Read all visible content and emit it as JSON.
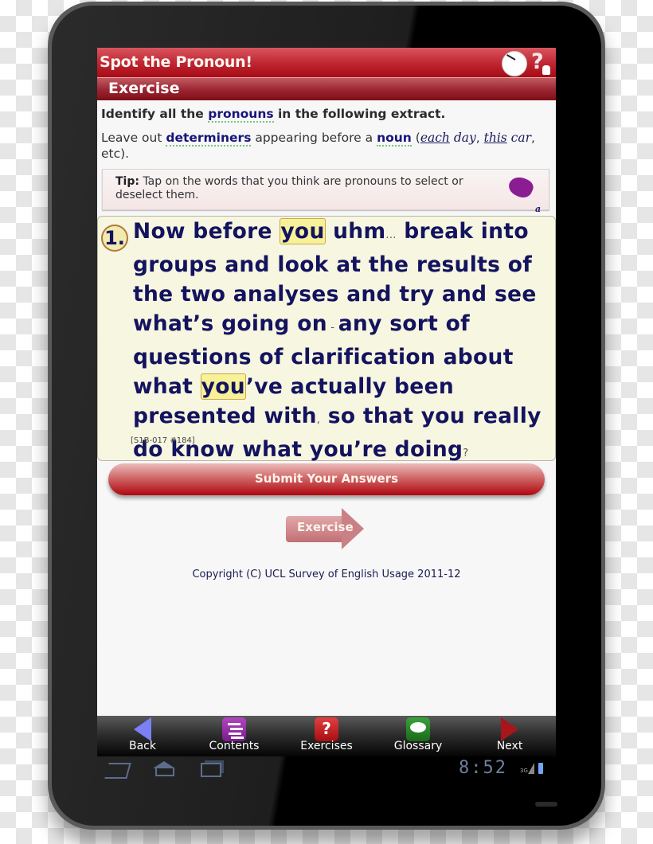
{
  "app": {
    "title": "Spot the Pronoun!",
    "section": "Exercise",
    "header_icons": [
      "clock-icon",
      "help-icon"
    ]
  },
  "instructions": {
    "line1_pre": "Identify all the ",
    "line1_term": "pronouns",
    "line1_post": " in the following extract.",
    "line2_pre": "Leave out ",
    "line2_term1": "determiners",
    "line2_mid": " appearing before a ",
    "line2_term2": "noun",
    "line2_paren_open": " (",
    "example1_word": "each",
    "example1_rest": " day",
    "sep": ", ",
    "example2_word": "this",
    "example2_rest": " car",
    "line2_end": ", etc)."
  },
  "tip": {
    "label": "Tip:",
    "text": " Tap on the words that you think are pronouns to select or deselect them.",
    "icon_label": "a"
  },
  "passage": {
    "number": "1.",
    "words": [
      {
        "t": "Now",
        "s": false
      },
      {
        "t": "before",
        "s": false
      },
      {
        "t": "you",
        "s": true
      },
      {
        "t": "uhm",
        "s": false
      },
      {
        "p": "..."
      },
      {
        "t": "break",
        "s": false
      },
      {
        "t": "into",
        "s": false
      },
      {
        "t": "groups",
        "s": false
      },
      {
        "t": "and",
        "s": false
      },
      {
        "t": "look",
        "s": false
      },
      {
        "t": "at",
        "s": false
      },
      {
        "t": "the",
        "s": false
      },
      {
        "t": "results",
        "s": false
      },
      {
        "t": "of",
        "s": false
      },
      {
        "t": "the",
        "s": false
      },
      {
        "t": "two",
        "s": false
      },
      {
        "t": "analyses",
        "s": false
      },
      {
        "t": "and",
        "s": false
      },
      {
        "t": "try",
        "s": false
      },
      {
        "t": "and",
        "s": false
      },
      {
        "t": "see",
        "s": false
      },
      {
        "t": "what’s",
        "s": false
      },
      {
        "t": "going",
        "s": false
      },
      {
        "t": "on",
        "s": false
      },
      {
        "p": " - "
      },
      {
        "t": "any",
        "s": false
      },
      {
        "t": "sort",
        "s": false
      },
      {
        "t": "of",
        "s": false
      },
      {
        "t": "questions",
        "s": false
      },
      {
        "t": "of",
        "s": false
      },
      {
        "t": "clarification",
        "s": false
      },
      {
        "t": "about",
        "s": false
      },
      {
        "t": "what",
        "s": false
      },
      {
        "t": "you",
        "s": true,
        "join": true
      },
      {
        "t": "’ve",
        "s": false
      },
      {
        "t": "actually",
        "s": false
      },
      {
        "t": "been",
        "s": false
      },
      {
        "t": "presented",
        "s": false
      },
      {
        "t": "with",
        "s": false
      },
      {
        "p": ","
      },
      {
        "t": "so",
        "s": false
      },
      {
        "t": "that",
        "s": false
      },
      {
        "t": "you",
        "s": false
      },
      {
        "t": "really",
        "s": false
      },
      {
        "t": "do",
        "s": false
      },
      {
        "t": "know",
        "s": false
      },
      {
        "t": "what",
        "s": false
      },
      {
        "t": "you’re",
        "s": false
      },
      {
        "t": "doing",
        "s": false
      },
      {
        "p": "?"
      }
    ],
    "reference": "[S1B-017 #184]"
  },
  "buttons": {
    "submit": "Submit Your Answers",
    "exercise": "Exercise"
  },
  "footer": {
    "copyright": "Copyright (C) UCL Survey of English Usage 2011-12"
  },
  "bottom_nav": [
    {
      "label": "Back",
      "icon": "back-arrow-icon"
    },
    {
      "label": "Contents",
      "icon": "contents-icon"
    },
    {
      "label": "Exercises",
      "icon": "exercises-icon"
    },
    {
      "label": "Glossary",
      "icon": "glossary-icon"
    },
    {
      "label": "Next",
      "icon": "next-arrow-icon"
    }
  ],
  "system_bar": {
    "time": "8:52",
    "network": "3G"
  },
  "colors": {
    "title_red": "#c02833",
    "text_navy": "#13135f",
    "highlight": "#f7f199",
    "passage_bg": "#f7f6e0"
  }
}
